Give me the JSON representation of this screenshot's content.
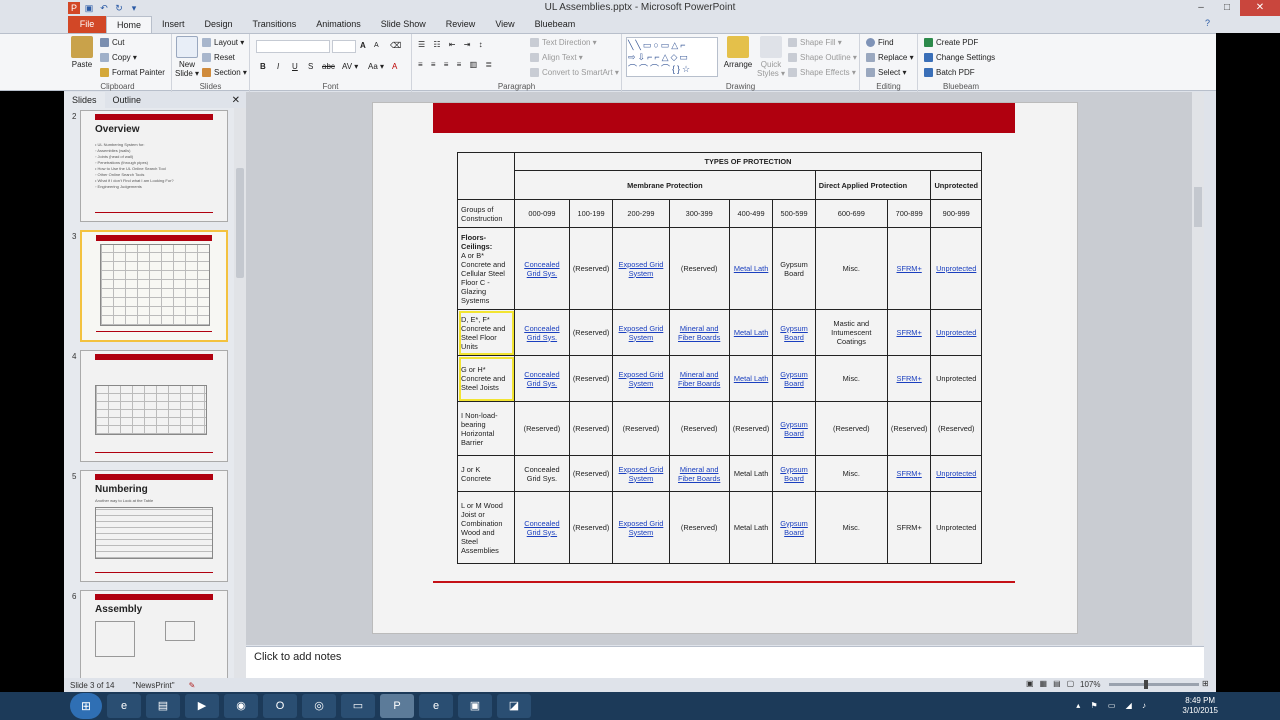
{
  "window": {
    "title": "UL Assemblies.pptx - Microsoft PowerPoint",
    "minimize": "–",
    "maximize": "□",
    "close": "✕",
    "help": "?"
  },
  "tabs": [
    "File",
    "Home",
    "Insert",
    "Design",
    "Transitions",
    "Animations",
    "Slide Show",
    "Review",
    "View",
    "Bluebeam"
  ],
  "ribbon": {
    "clipboard": {
      "label": "Clipboard",
      "paste": "Paste",
      "cut": "Cut",
      "copy": "Copy ▾",
      "format_painter": "Format Painter"
    },
    "slides": {
      "label": "Slides",
      "new_slide": "New Slide ▾",
      "layout": "Layout ▾",
      "reset": "Reset",
      "section": "Section ▾"
    },
    "font": {
      "label": "Font",
      "bold": "B",
      "italic": "I",
      "underline": "U",
      "strike": "S",
      "shadow": "abc",
      "spacing": "AV ▾",
      "case": "Aa ▾",
      "grow": "A",
      "shrink": "A"
    },
    "paragraph": {
      "label": "Paragraph",
      "text_direction": "Text Direction ▾",
      "align_text": "Align Text ▾",
      "smartart": "Convert to SmartArt ▾"
    },
    "drawing": {
      "label": "Drawing",
      "arrange": "Arrange",
      "quick_styles": "Quick Styles ▾",
      "shape_fill": "Shape Fill ▾",
      "shape_outline": "Shape Outline ▾",
      "shape_effects": "Shape Effects ▾"
    },
    "editing": {
      "label": "Editing",
      "find": "Find",
      "replace": "Replace ▾",
      "select": "Select ▾"
    },
    "bluebeam": {
      "label": "Bluebeam",
      "create_pdf": "Create PDF",
      "change_settings": "Change Settings",
      "batch_pdf": "Batch PDF"
    }
  },
  "panel": {
    "tab_slides": "Slides",
    "tab_outline": "Outline",
    "close": "✕"
  },
  "thumbnails": [
    {
      "num": "2",
      "title": "Overview",
      "lines": [
        "• UL Numbering System for:",
        "  ◦ Assemblies (walls)",
        "  ◦ Joints (head of wall)",
        "  ◦ Penetrations (through pipes)",
        "• How to Use the UL Online Search Tool",
        "  ◦ Other Online Search Tools",
        "• What if I don't Find what I am Looking For?",
        "  ◦ Engineering Judgements"
      ]
    },
    {
      "num": "3",
      "title": "",
      "lines": []
    },
    {
      "num": "4",
      "title": "",
      "lines": []
    },
    {
      "num": "5",
      "title": "Numbering",
      "lines": [
        "Another way to Look at the Table"
      ]
    },
    {
      "num": "6",
      "title": "Assembly",
      "lines": []
    }
  ],
  "table": {
    "types_header": "TYPES OF PROTECTION",
    "membrane": "Membrane Protection",
    "direct": "Direct Applied Protection",
    "unprotected": "Unprotected",
    "groups": "Groups of Construction",
    "ranges": [
      "000-099",
      "100-199",
      "200-299",
      "300-399",
      "400-499",
      "500-599",
      "600-699",
      "700-899",
      "900-999"
    ],
    "rows": [
      {
        "label_bold": "Floors-Ceilings:",
        "label": "A or B* Concrete and Cellular Steel Floor C - Glazing Systems",
        "cells": [
          "Concealed Grid Sys.",
          "(Reserved)",
          "Exposed Grid System",
          "(Reserved)",
          "Metal Lath",
          "Gypsum Board",
          "Misc.",
          "SFRM+",
          "Unprotected"
        ]
      },
      {
        "label_bold": "",
        "label": "D, E*, F* Concrete and Steel Floor Units",
        "cells": [
          "Concealed Grid Sys.",
          "(Reserved)",
          "Exposed Grid System",
          "Mineral and Fiber Boards",
          "Metal Lath",
          "Gypsum Board",
          "Mastic and Intumescent Coatings",
          "SFRM+",
          "Unprotected"
        ]
      },
      {
        "label_bold": "",
        "label": "G or H* Concrete and Steel Joists",
        "cells": [
          "Concealed Grid Sys.",
          "(Reserved)",
          "Exposed Grid System",
          "Mineral and Fiber Boards",
          "Metal Lath",
          "Gypsum Board",
          "Misc.",
          "SFRM+",
          "Unprotected"
        ]
      },
      {
        "label_bold": "",
        "label": "I Non-load-bearing Horizontal Barrier",
        "cells": [
          "(Reserved)",
          "(Reserved)",
          "(Reserved)",
          "(Reserved)",
          "(Reserved)",
          "Gypsum Board",
          "(Reserved)",
          "(Reserved)",
          "(Reserved)"
        ]
      },
      {
        "label_bold": "",
        "label": "J or K Concrete",
        "cells": [
          "Concealed Grid Sys.",
          "(Reserved)",
          "Exposed Grid System",
          "Mineral and Fiber Boards",
          "Metal Lath",
          "Gypsum Board",
          "Misc.",
          "SFRM+",
          "Unprotected"
        ]
      },
      {
        "label_bold": "",
        "label": "L or M Wood Joist or Combination Wood and Steel Assemblies",
        "cells": [
          "Concealed Grid Sys.",
          "(Reserved)",
          "Exposed Grid System",
          "(Reserved)",
          "Metal Lath",
          "Gypsum Board",
          "Misc.",
          "SFRM+",
          "Unprotected"
        ]
      }
    ]
  },
  "notes_placeholder": "Click to add notes",
  "status": {
    "slide": "Slide 3 of 14",
    "theme": "\"NewsPrint\"",
    "zoom": "107%"
  },
  "clock": {
    "time": "8:49 PM",
    "date": "3/10/2015"
  },
  "colors": {
    "accent_red": "#b0000f",
    "file_tab": "#d24726",
    "highlight": "#f2e431",
    "link": "#1a3fbf"
  }
}
